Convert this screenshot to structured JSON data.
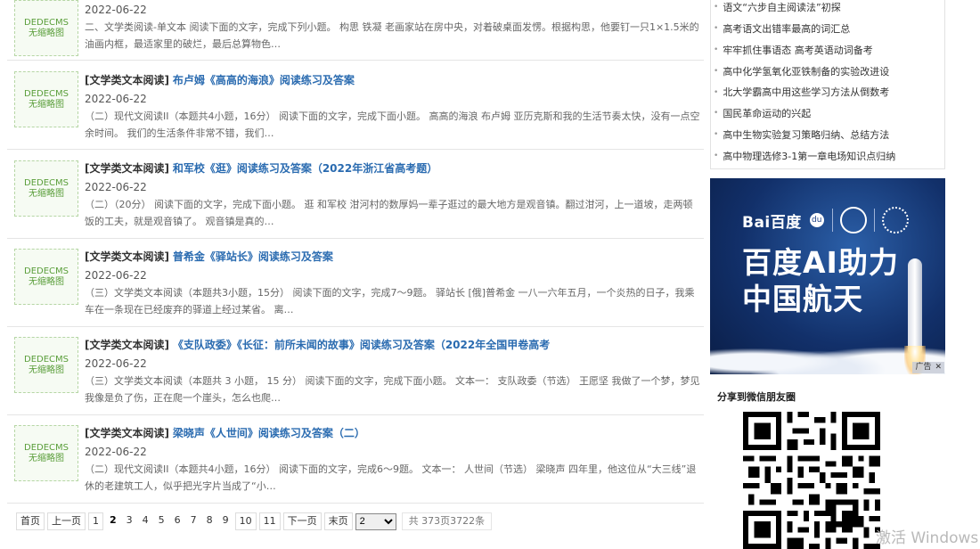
{
  "thumb_text": [
    "DEDECMS",
    "无缩略图"
  ],
  "articles": [
    {
      "category": "",
      "title": "",
      "date": "2022-06-22",
      "desc": "二、文学类阅读-单文本 阅读下面的文字，完成下列小题。 构思 铁凝 老画家站在房中央，对着破桌面发愣。根据构思，他要钉一只1×1.5米的油画内框，最适家里的破烂，最后总算物色…"
    },
    {
      "category": "[文学类文本阅读]",
      "title": "布卢姆《高高的海浪》阅读练习及答案",
      "date": "2022-06-22",
      "desc": "（二）现代文阅读II（本题共4小题，16分） 阅读下面的文字，完成下面小题。 高高的海浪 布卢姆 亚历克斯和我的生活节奏太快，没有一点空余时间。 我们的生活条件非常不错，我们…"
    },
    {
      "category": "[文学类文本阅读]",
      "title": "和军校《逛》阅读练习及答案（2022年浙江省高考题）",
      "date": "2022-06-22",
      "desc": "（二）（20分） 阅读下面的文字，完成下面小题。 逛 和军校 泔河村的数厚妈一辈子逛过的最大地方是观音镇。翻过泔河，上一道坡，走两顿饭的工夫，就是观音镇了。 观音镇是真的…"
    },
    {
      "category": "[文学类文本阅读]",
      "title": "普希金《驿站长》阅读练习及答案",
      "date": "2022-06-22",
      "desc": "（三）文学类文本阅读（本题共3小题，15分） 阅读下面的文字，完成7～9题。 驿站长 [俄]普希金 一八一六年五月，一个炎热的日子，我乘车在一条现在已经废弃的驿道上经过某省。 离…"
    },
    {
      "category": "[文学类文本阅读]",
      "title": "《支队政委》《长征：前所未闻的故事》阅读练习及答案（2022年全国甲卷高考",
      "date": "2022-06-22",
      "desc": "（三）文学类文本阅读（本题共 3 小题， 15 分） 阅读下面的文字，完成下面小题。 文本一： 支队政委（节选） 王愿坚 我做了一个梦，梦见我像是负了伤，正在爬一个崖头，怎么也爬…"
    },
    {
      "category": "[文学类文本阅读]",
      "title": "梁晓声《人世间》阅读练习及答案（二）",
      "date": "2022-06-22",
      "desc": "（二）现代文阅读II（本题共4小题，16分） 阅读下面的文字，完成6～9题。 文本一： 人世间（节选） 梁晓声 四年里，他这位从“大三线”退休的老建筑工人，似乎把光字片当成了“小…"
    }
  ],
  "pagination": {
    "first": "首页",
    "prev": "上一页",
    "pages": [
      "1",
      "2",
      "3",
      "4",
      "5",
      "6",
      "7",
      "8",
      "9",
      "10",
      "11"
    ],
    "current": "2",
    "next": "下一页",
    "last": "末页",
    "select_value": "2",
    "summary": "共 373页3722条"
  },
  "sidebar_links": [
    "语文“六步自主阅读法”初探",
    "高考语文出错率最高的词汇总",
    "牢牢抓住事语态 高考英语动词备考",
    "高中化学氢氧化亚铁制备的实验改进设",
    "北大学霸高中用这些学习方法从倒数考",
    "国民革命运动的兴起",
    "高中生物实验复习策略归纳、总结方法",
    "高中物理选修3-1第一章电场知识点归纳"
  ],
  "ad": {
    "brand": "Bai百度",
    "paw": "du",
    "partner1": "中国探月 CLEP",
    "partner2": "中国航天",
    "line1": "百度AI助力",
    "line2": "中国航天",
    "tag": "广告",
    "close": "✕"
  },
  "share_label": "分享到微信朋友圈",
  "watermark": "激活 Windows"
}
